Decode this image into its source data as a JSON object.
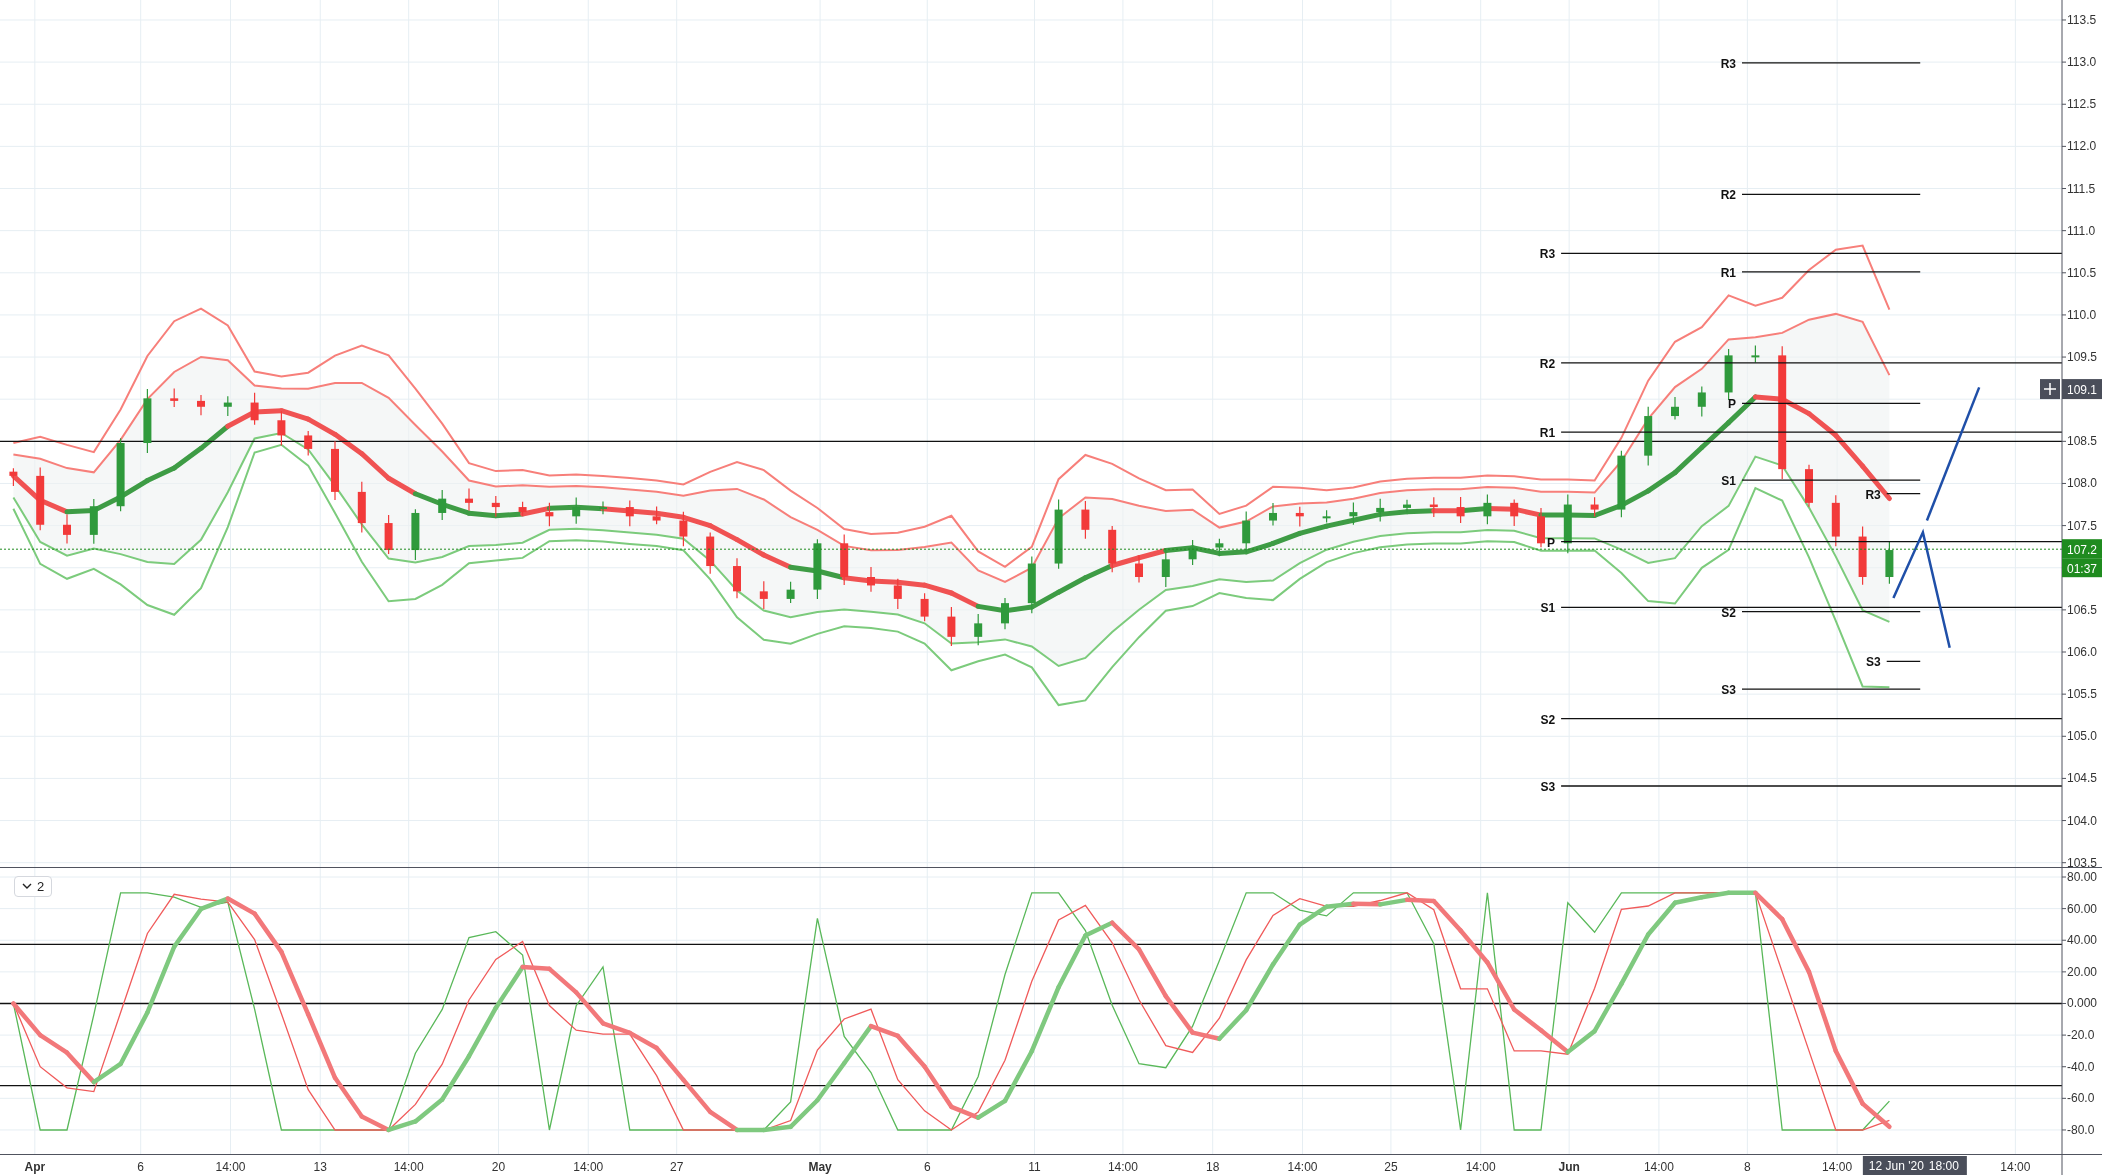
{
  "price_chart": {
    "scale": [
      "113.5",
      "113.0",
      "112.5",
      "112.0",
      "111.5",
      "111.0",
      "110.5",
      "110.0",
      "109.5",
      "108.5",
      "108.0",
      "107.5",
      "106.5",
      "106.0",
      "105.5",
      "105.0",
      "104.5",
      "104.0",
      "103.5"
    ],
    "pivots": [
      {
        "label": "R3"
      },
      {
        "label": "R2"
      },
      {
        "label": "R1"
      },
      {
        "label": "P"
      },
      {
        "label": "S1"
      },
      {
        "label": "S2"
      },
      {
        "label": "S3"
      },
      {
        "label": "R3"
      },
      {
        "label": "R2"
      },
      {
        "label": "R1"
      },
      {
        "label": "P"
      },
      {
        "label": "S1"
      },
      {
        "label": "S2"
      },
      {
        "label": "S3"
      },
      {
        "label": "R3"
      },
      {
        "label": "S3"
      }
    ],
    "crosshair_price": {
      "label": "109.1"
    },
    "last_price": {
      "label": "107.2",
      "countdown": "01:37"
    }
  },
  "oscillator": {
    "button": {
      "label": "2"
    },
    "scale": [
      "80.00",
      "60.00",
      "40.00",
      "20.00",
      "0.000",
      "-20.0",
      "-40.0",
      "-60.0",
      "-80.0"
    ]
  },
  "time_axis": {
    "labels": [
      {
        "label": "Apr"
      },
      {
        "label": "6"
      },
      {
        "label": "14:00"
      },
      {
        "label": "13"
      },
      {
        "label": "14:00"
      },
      {
        "label": "20"
      },
      {
        "label": "14:00"
      },
      {
        "label": "27"
      },
      {
        "label": "May"
      },
      {
        "label": "6"
      },
      {
        "label": "11"
      },
      {
        "label": "14:00"
      },
      {
        "label": "18"
      },
      {
        "label": "14:00"
      },
      {
        "label": "25"
      },
      {
        "label": "14:00"
      },
      {
        "label": "Jun"
      },
      {
        "label": "14:00"
      },
      {
        "label": "8"
      },
      {
        "label": "14:00"
      },
      {
        "label": "14:00"
      }
    ],
    "crosshair": {
      "date": "12 Jun '20",
      "time": "18:00"
    }
  }
}
